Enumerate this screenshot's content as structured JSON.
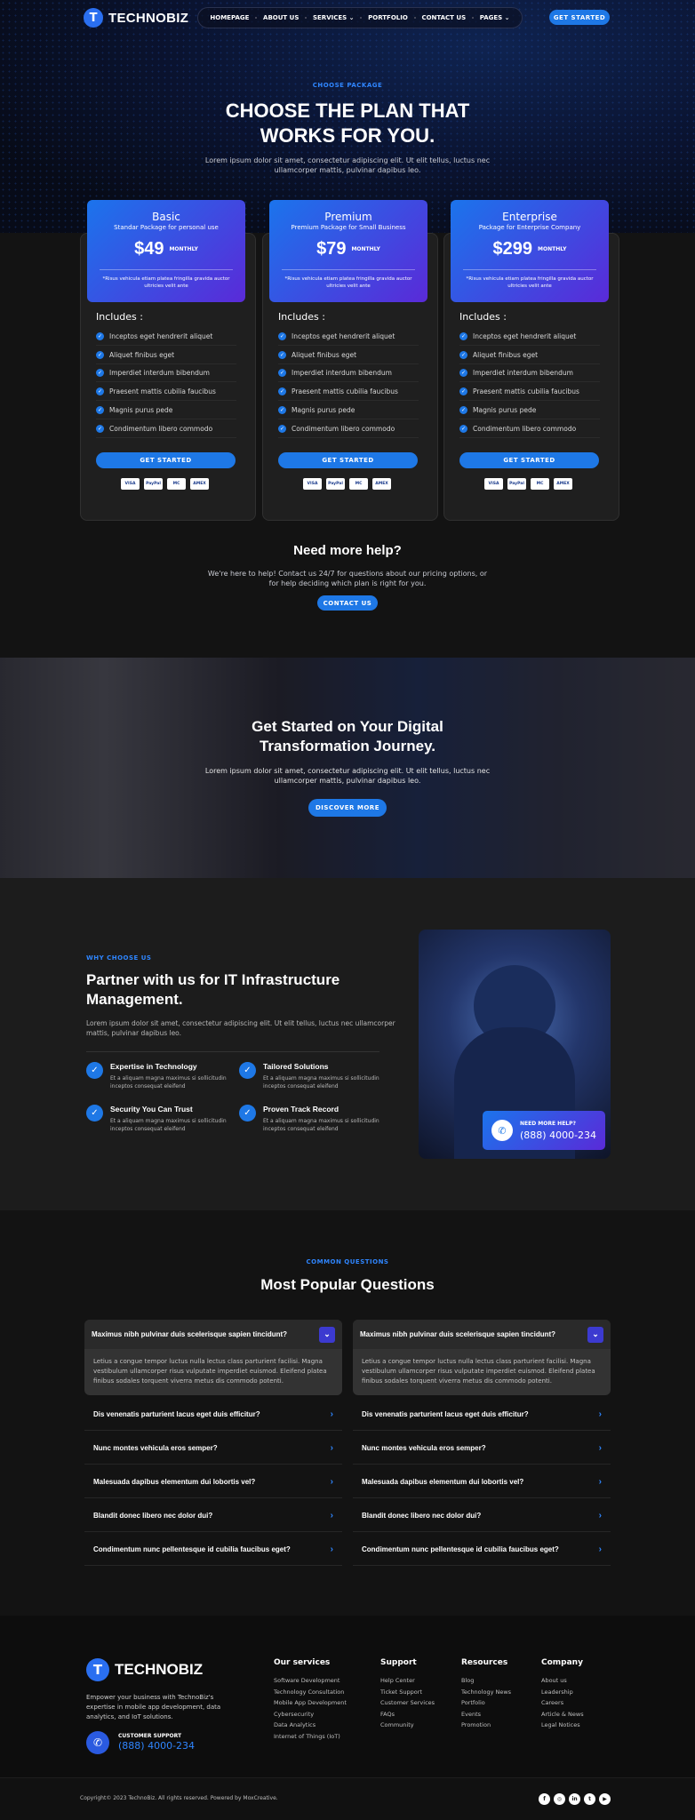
{
  "header": {
    "logo": "TECHNOBIZ",
    "nav": [
      "HOMEPAGE",
      "ABOUT US",
      "SERVICES",
      "PORTFOLIO",
      "CONTACT US",
      "PAGES"
    ],
    "cta": "GET STARTED"
  },
  "pricing": {
    "eyebrow": "CHOOSE PACKAGE",
    "title_line1": "CHOOSE THE PLAN THAT",
    "title_line2": "WORKS FOR YOU.",
    "subtitle_line1": "Lorem ipsum dolor sit amet, consectetur adipiscing elit. Ut elit tellus, luctus nec",
    "subtitle_line2": "ullamcorper mattis, pulvinar dapibus leo.",
    "includes_label": "Includes :",
    "cta": "GET STARTED",
    "payments": [
      "VISA",
      "PayPal",
      "MC",
      "AMEX"
    ],
    "plans": [
      {
        "name": "Basic",
        "desc": "Standar Package for personal use",
        "price": "$49",
        "period": "MONTHLY",
        "note_line1": "*Risus vehicula etiam platea fringilla gravida auctor",
        "note_line2": "ultricies velit ante"
      },
      {
        "name": "Premium",
        "desc": "Premium Package for Small Business",
        "price": "$79",
        "period": "MONTHLY",
        "note_line1": "*Risus vehicula etiam platea fringilla gravida auctor",
        "note_line2": "ultricies velit ante"
      },
      {
        "name": "Enterprise",
        "desc": "Package for Enterprise Company",
        "price": "$299",
        "period": "MONTHLY",
        "note_line1": "*Risus vehicula etiam platea fringilla gravida auctor",
        "note_line2": "ultricies velit ante"
      }
    ],
    "features": [
      "Inceptos eget hendrerit aliquet",
      "Aliquet finibus eget",
      "Imperdiet interdum bibendum",
      "Praesent mattis cubilia faucibus",
      "Magnis purus pede",
      "Condimentum libero commodo"
    ]
  },
  "help": {
    "title": "Need more help?",
    "text_line1": "We're here to help! Contact us 24/7 for questions about our pricing options, or",
    "text_line2": "for help deciding which plan is right for you.",
    "cta": "CONTACT US"
  },
  "banner": {
    "title_line1": "Get Started on Your Digital",
    "title_line2": "Transformation Journey.",
    "text_line1": "Lorem ipsum dolor sit amet, consectetur adipiscing elit. Ut elit tellus, luctus nec",
    "text_line2": "ullamcorper mattis, pulvinar dapibus leo.",
    "cta": "DISCOVER MORE"
  },
  "why": {
    "eyebrow": "WHY CHOOSE US",
    "title_line1": "Partner with us for IT Infrastructure",
    "title_line2": "Management.",
    "text_line1": "Lorem ipsum dolor sit amet, consectetur adipiscing elit. Ut elit tellus, luctus nec ullamcorper",
    "text_line2": "mattis, pulvinar dapibus leo.",
    "items": [
      {
        "title": "Expertise in Technology",
        "line1": "Et a aliquam magna maximus si sollicitudin",
        "line2": "inceptos consequat eleifend"
      },
      {
        "title": "Tailored Solutions",
        "line1": "Et a aliquam magna maximus si sollicitudin",
        "line2": "inceptos consequat eleifend"
      },
      {
        "title": "Security You Can Trust",
        "line1": "Et a aliquam magna maximus si sollicitudin",
        "line2": "inceptos consequat eleifend"
      },
      {
        "title": "Proven Track Record",
        "line1": "Et a aliquam magna maximus si sollicitudin",
        "line2": "inceptos consequat eleifend"
      }
    ],
    "help_label": "NEED MORE HELP?",
    "help_phone": "(888) 4000-234"
  },
  "faq": {
    "eyebrow": "COMMON QUESTIONS",
    "title": "Most Popular Questions",
    "open_question": "Maximus nibh pulvinar duis scelerisque sapien tincidunt?",
    "open_answer_line1": "Letius a congue tempor luctus nulla lectus class parturient facilisi. Magna",
    "open_answer_line2": "vestibulum ullamcorper risus vulputate imperdiet euismod. Eleifend platea",
    "open_answer_line3": "finibus sodales torquent viverra metus dis commodo potenti.",
    "questions": [
      "Dis venenatis parturient lacus eget duis efficitur?",
      "Nunc montes vehicula eros semper?",
      "Malesuada dapibus elementum dui lobortis vel?",
      "Blandit donec libero nec dolor dui?",
      "Condimentum nunc pellentesque id cubilia faucibus eget?"
    ]
  },
  "footer": {
    "logo": "TECHNOBIZ",
    "about_line1": "Empower your business with TechnoBiz's",
    "about_line2": "expertise in mobile app development, data",
    "about_line3": "analytics, and IoT solutions.",
    "support_label": "CUSTOMER SUPPORT",
    "support_phone": "(888) 4000-234",
    "columns": [
      {
        "title": "Our services",
        "links": [
          "Software Development",
          "Technology Consultation",
          "Mobile App Development",
          "Cybersecurity",
          "Data Analytics",
          "Internet of Things (IoT)"
        ]
      },
      {
        "title": "Support",
        "links": [
          "Help Center",
          "Ticket Support",
          "Customer Services",
          "FAQs",
          "Community"
        ]
      },
      {
        "title": "Resources",
        "links": [
          "Blog",
          "Technology News",
          "Portfolio",
          "Events",
          "Promotion"
        ]
      },
      {
        "title": "Company",
        "links": [
          "About us",
          "Leadership",
          "Careers",
          "Article & News",
          "Legal Notices"
        ]
      }
    ],
    "copyright": "Copyright© 2023 TechnoBiz. All rights reserved. Powered by MoxCreative.",
    "social": [
      "f",
      "◎",
      "in",
      "t",
      "▶"
    ]
  },
  "colors": {
    "accent": "#1e78e6",
    "gradient_end": "#5a2ad8",
    "eyebrow": "#2f86ff"
  }
}
